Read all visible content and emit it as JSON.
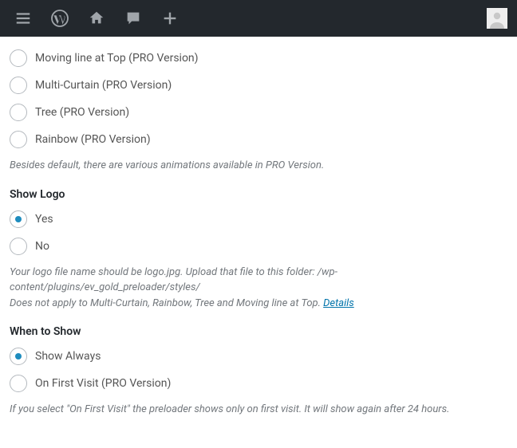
{
  "adminbar": {
    "icons": [
      "menu",
      "wordpress",
      "home",
      "comment",
      "add"
    ],
    "avatar": true
  },
  "sections": {
    "animation": {
      "options": [
        {
          "label": "Moving line at Top (PRO Version)",
          "checked": false
        },
        {
          "label": "Multi-Curtain (PRO Version)",
          "checked": false
        },
        {
          "label": "Tree (PRO Version)",
          "checked": false
        },
        {
          "label": "Rainbow (PRO Version)",
          "checked": false
        }
      ],
      "description": "Besides default, there are various animations available in PRO Version."
    },
    "show_logo": {
      "heading": "Show Logo",
      "options": [
        {
          "label": "Yes",
          "checked": true
        },
        {
          "label": "No",
          "checked": false
        }
      ],
      "description_line1": "Your logo file name should be logo.jpg. Upload that file to this folder: /wp-content/plugins/ev_gold_preloader/styles/",
      "description_line2": "Does not apply to Multi-Curtain, Rainbow, Tree and Moving line at Top. ",
      "details_link": "Details"
    },
    "when_to_show": {
      "heading": "When to Show",
      "options": [
        {
          "label": "Show Always",
          "checked": true
        },
        {
          "label": "On First Visit (PRO Version)",
          "checked": false
        }
      ],
      "description": "If you select \"On First Visit\" the preloader shows only on first visit. It will show again after 24 hours."
    }
  }
}
